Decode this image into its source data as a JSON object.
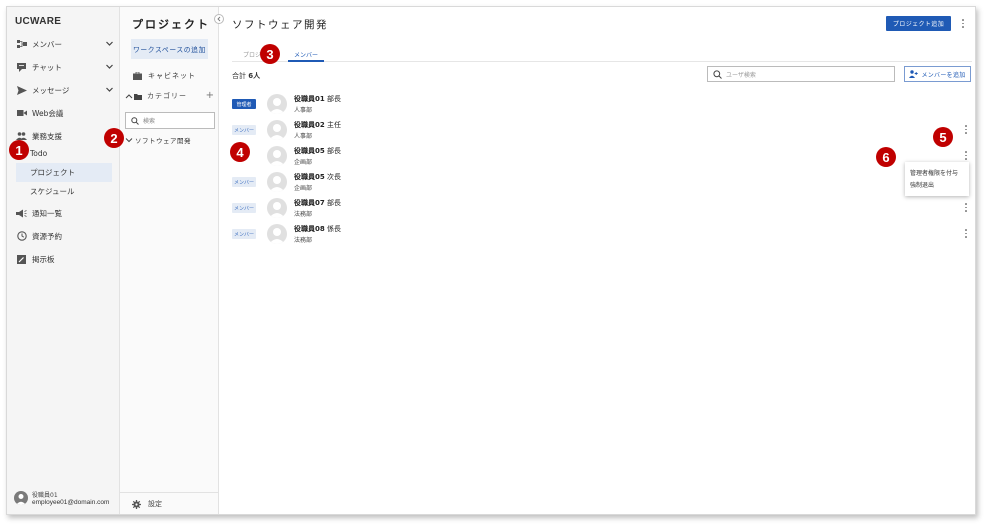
{
  "app": {
    "brand": "UCWARE"
  },
  "sidebar": {
    "items": [
      {
        "label": "メンバー",
        "icon": "org-chart-icon",
        "has_chevron": true
      },
      {
        "label": "チャット",
        "icon": "chat-icon",
        "has_chevron": true
      },
      {
        "label": "メッセージ",
        "icon": "send-icon",
        "has_chevron": true
      },
      {
        "label": "Web会議",
        "icon": "video-icon",
        "has_chevron": false
      },
      {
        "label": "業務支援",
        "icon": "people-icon",
        "has_chevron": false
      }
    ],
    "sub_items": [
      {
        "label": "Todo",
        "active": false
      },
      {
        "label": "プロジェクト",
        "active": true
      },
      {
        "label": "スケジュール",
        "active": false
      }
    ],
    "bottom_items": [
      {
        "label": "通知一覧",
        "icon": "megaphone-icon"
      },
      {
        "label": "資源予約",
        "icon": "clock-icon"
      },
      {
        "label": "掲示板",
        "icon": "board-icon"
      }
    ],
    "user": {
      "name": "役職員01",
      "email": "employee01@domain.com"
    }
  },
  "project_panel": {
    "title": "プロジェクト",
    "workspace_button": "ワークスペースの追加",
    "cabinet_label": "キャビネット",
    "category_label": "カテゴリー",
    "search_placeholder": "検索",
    "tree_item": "ソフトウェア開発",
    "settings_label": "設定"
  },
  "main": {
    "title": "ソフトウェア開発",
    "add_project_button": "プロジェクト追加",
    "tabs": [
      {
        "label": "プロジ",
        "active": false
      },
      {
        "label": "メンバー",
        "active": true
      }
    ],
    "total_label": "合計",
    "total_count": "6人",
    "user_search_placeholder": "ユーザ検索",
    "add_member_button": "メンバーを追加",
    "members": [
      {
        "role": "管理者",
        "is_admin": true,
        "name": "役職員01",
        "title": "部長",
        "dept": "人事部"
      },
      {
        "role": "メンバー",
        "is_admin": false,
        "name": "役職員02",
        "title": "主任",
        "dept": "人事部"
      },
      {
        "role": "",
        "is_admin": false,
        "name": "役職員05",
        "title": "部長",
        "dept": "企画部"
      },
      {
        "role": "メンバー",
        "is_admin": false,
        "name": "役職員05",
        "title": "次長",
        "dept": "企画部"
      },
      {
        "role": "メンバー",
        "is_admin": false,
        "name": "役職員07",
        "title": "部長",
        "dept": "法務部"
      },
      {
        "role": "メンバー",
        "is_admin": false,
        "name": "役職員08",
        "title": "係長",
        "dept": "法務部"
      }
    ],
    "context_menu": [
      "管理者権限を付与",
      "強制退出"
    ]
  },
  "callouts": [
    "1",
    "2",
    "3",
    "4",
    "5",
    "6"
  ],
  "colors": {
    "accent": "#1f5ab5",
    "callout": "#c00000",
    "active_bg": "#e4ebf5"
  }
}
